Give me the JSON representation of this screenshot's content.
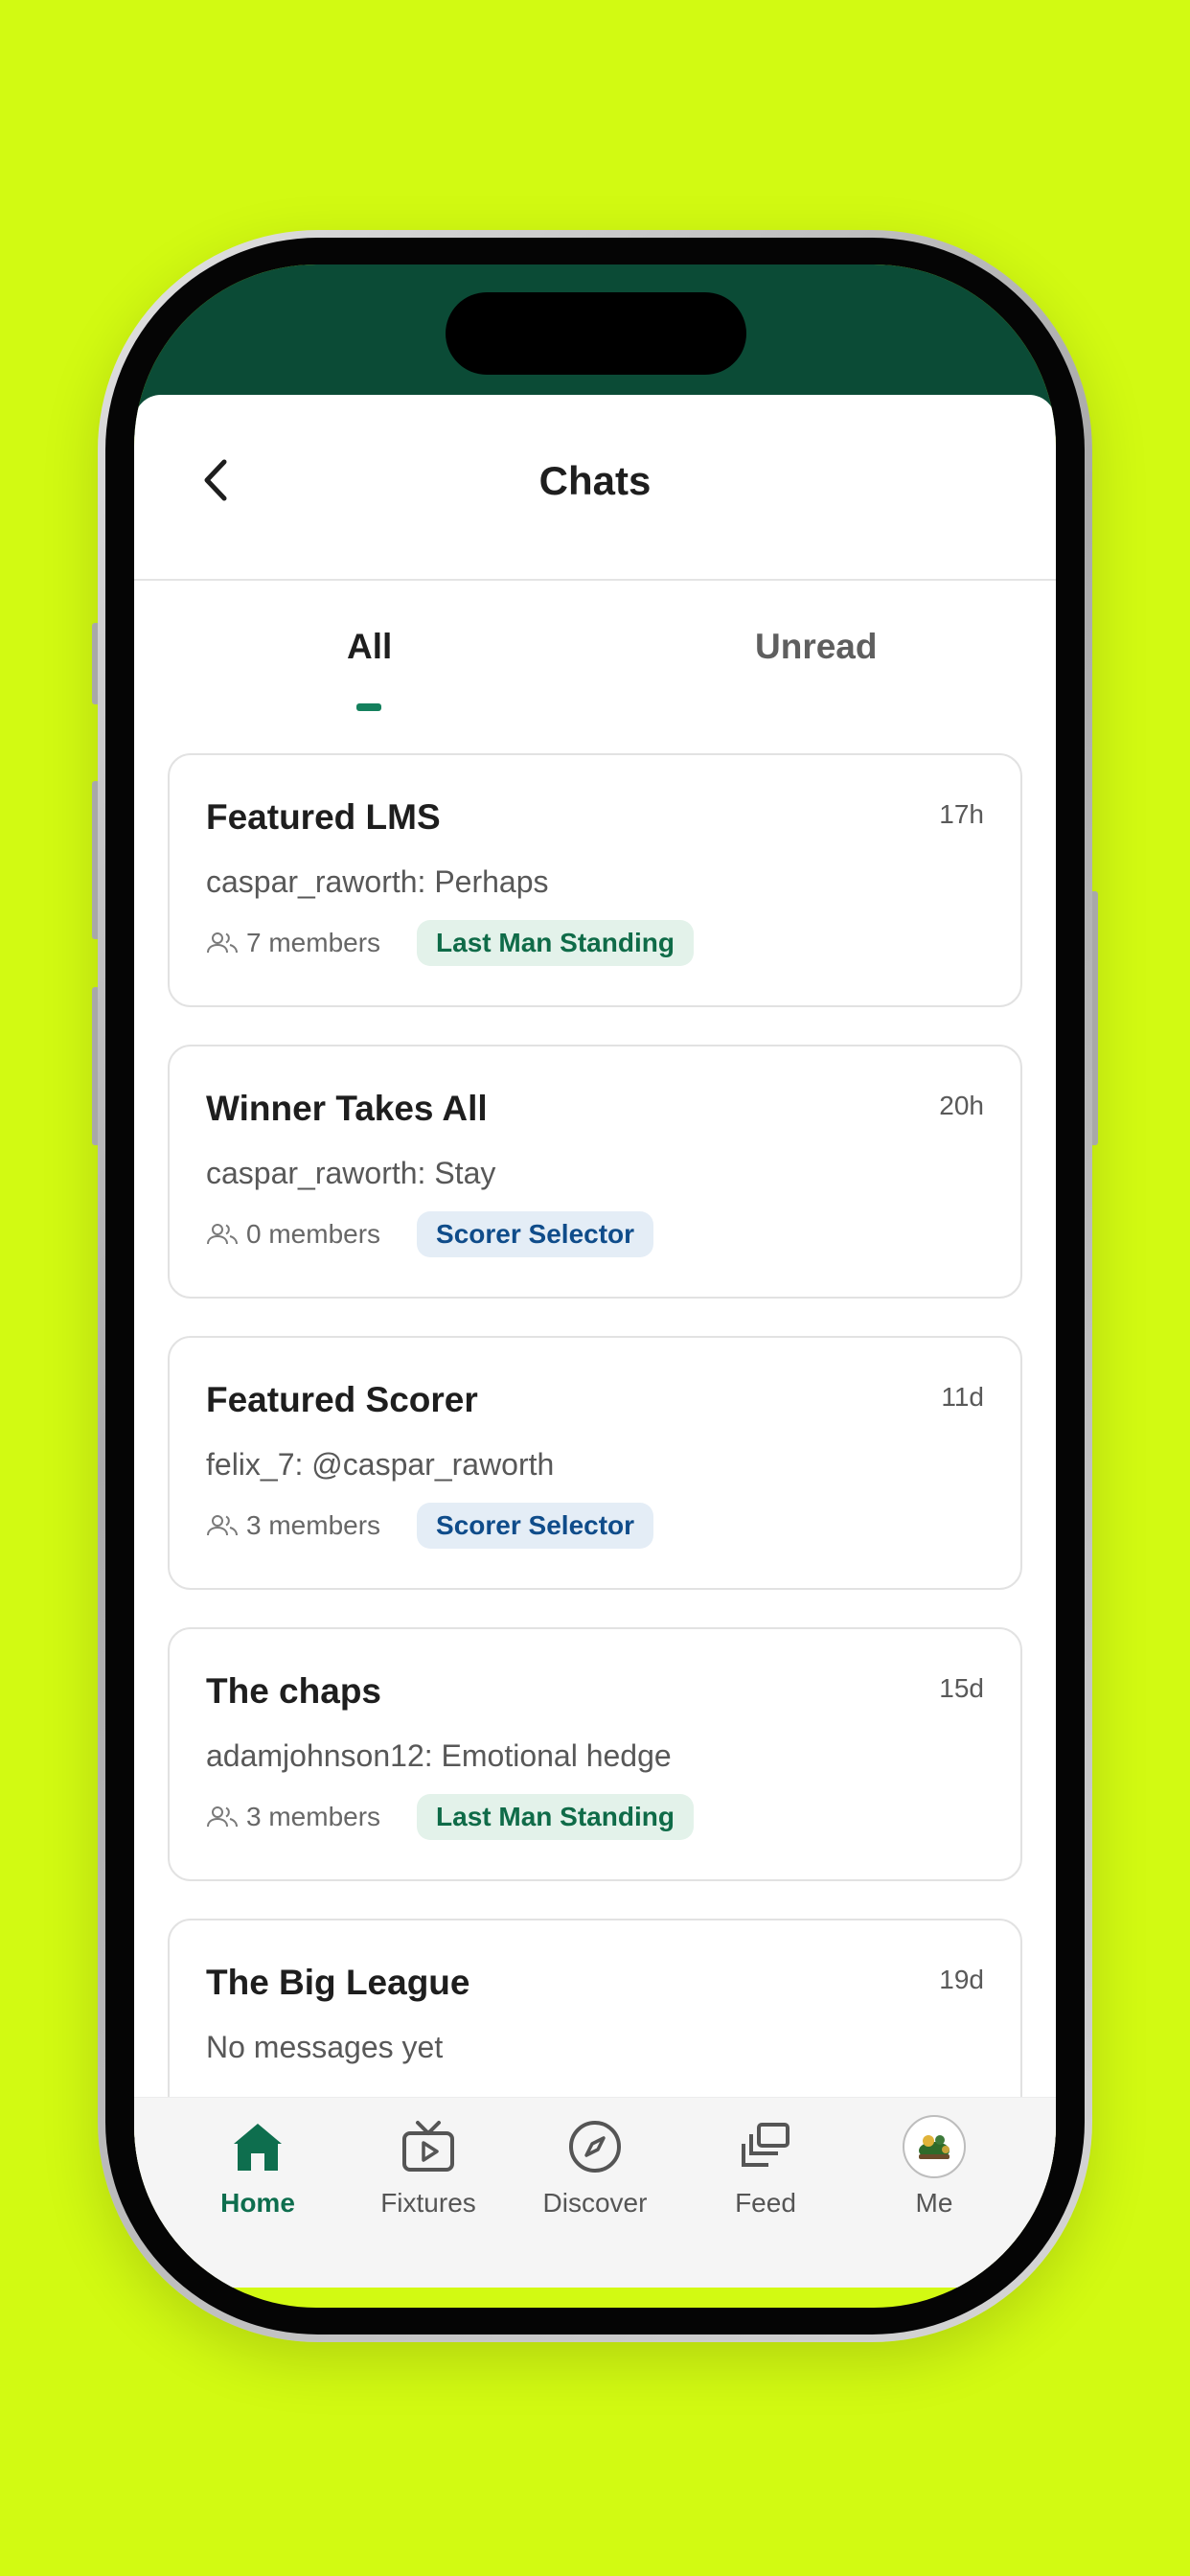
{
  "header": {
    "title": "Chats"
  },
  "tabs": [
    {
      "label": "All",
      "active": true
    },
    {
      "label": "Unread",
      "active": false
    }
  ],
  "chats": [
    {
      "name": "Featured LMS",
      "time": "17h",
      "last_message": "caspar_raworth: Perhaps",
      "members": "7 members",
      "tag": "Last Man Standing",
      "tag_type": "lms"
    },
    {
      "name": "Winner Takes All",
      "time": "20h",
      "last_message": "caspar_raworth: Stay",
      "members": "0 members",
      "tag": "Scorer Selector",
      "tag_type": "ss"
    },
    {
      "name": "Featured Scorer",
      "time": "11d",
      "last_message": "felix_7: @caspar_raworth",
      "members": "3 members",
      "tag": "Scorer Selector",
      "tag_type": "ss"
    },
    {
      "name": "The chaps",
      "time": "15d",
      "last_message": "adamjohnson12: Emotional hedge",
      "members": "3 members",
      "tag": "Last Man Standing",
      "tag_type": "lms"
    },
    {
      "name": "The Big League",
      "time": "19d",
      "last_message": "No messages yet"
    }
  ],
  "bottom_nav": [
    {
      "label": "Home",
      "icon": "home-icon",
      "active": true
    },
    {
      "label": "Fixtures",
      "icon": "tv-icon",
      "active": false
    },
    {
      "label": "Discover",
      "icon": "compass-icon",
      "active": false
    },
    {
      "label": "Feed",
      "icon": "stack-icon",
      "active": false
    },
    {
      "label": "Me",
      "icon": "avatar",
      "active": false
    }
  ],
  "colors": {
    "background": "#d2fa12",
    "accent": "#14805d",
    "status_band": "#0b4b36",
    "tag_lms_bg": "#e3f2ea",
    "tag_lms_text": "#0f6b48",
    "tag_ss_bg": "#e4edf6",
    "tag_ss_text": "#0f4c8a"
  }
}
